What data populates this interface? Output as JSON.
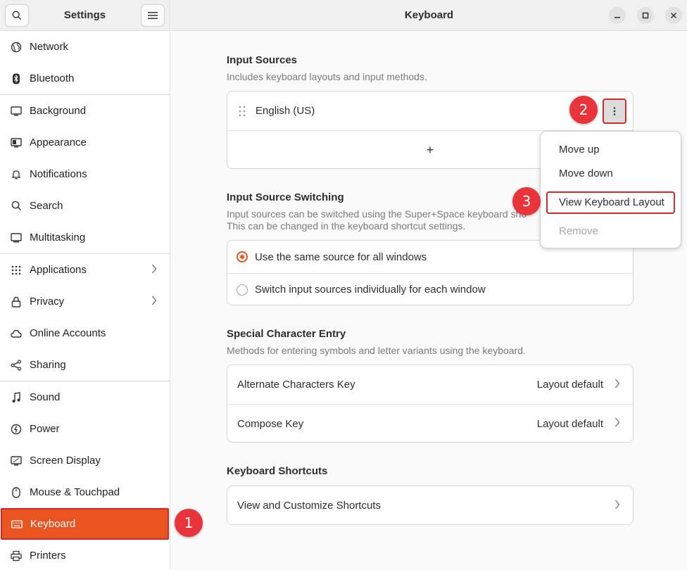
{
  "sidebar": {
    "title": "Settings",
    "items": [
      {
        "label": "Network",
        "icon": "globe-icon"
      },
      {
        "label": "Bluetooth",
        "icon": "bluetooth-icon"
      },
      {
        "label": "Background",
        "icon": "monitor-icon"
      },
      {
        "label": "Appearance",
        "icon": "appearance-icon"
      },
      {
        "label": "Notifications",
        "icon": "bell-icon"
      },
      {
        "label": "Search",
        "icon": "search-icon"
      },
      {
        "label": "Multitasking",
        "icon": "multitasking-icon"
      },
      {
        "label": "Applications",
        "icon": "grid-icon"
      },
      {
        "label": "Privacy",
        "icon": "lock-icon"
      },
      {
        "label": "Online Accounts",
        "icon": "cloud-icon"
      },
      {
        "label": "Sharing",
        "icon": "share-icon"
      },
      {
        "label": "Sound",
        "icon": "music-note-icon"
      },
      {
        "label": "Power",
        "icon": "power-icon"
      },
      {
        "label": "Screen Display",
        "icon": "display-icon"
      },
      {
        "label": "Mouse & Touchpad",
        "icon": "mouse-icon"
      },
      {
        "label": "Keyboard",
        "icon": "keyboard-icon"
      },
      {
        "label": "Printers",
        "icon": "printer-icon"
      }
    ]
  },
  "header": {
    "title": "Keyboard"
  },
  "input_sources": {
    "title": "Input Sources",
    "subtitle": "Includes keyboard layouts and input methods.",
    "source": "English (US)",
    "add_label": "+"
  },
  "switching": {
    "title": "Input Source Switching",
    "subtitle_line1": "Input sources can be switched using the Super+Space keyboard sho",
    "subtitle_line2": "This can be changed in the keyboard shortcut settings.",
    "option_same": "Use the same source for all windows",
    "option_individual": "Switch input sources individually for each window"
  },
  "special": {
    "title": "Special Character Entry",
    "subtitle": "Methods for entering symbols and letter variants using the keyboard.",
    "alt_label": "Alternate Characters Key",
    "alt_value": "Layout default",
    "compose_label": "Compose Key",
    "compose_value": "Layout default"
  },
  "shortcuts": {
    "title": "Keyboard Shortcuts",
    "row": "View and Customize Shortcuts"
  },
  "popover": {
    "move_up": "Move up",
    "move_down": "Move down",
    "view_layout": "View Keyboard Layout",
    "remove": "Remove"
  },
  "badges": [
    "1",
    "2",
    "3"
  ],
  "colors": {
    "accent": "#e95420",
    "highlight": "#d02a2a",
    "badge": "#e8343a"
  }
}
